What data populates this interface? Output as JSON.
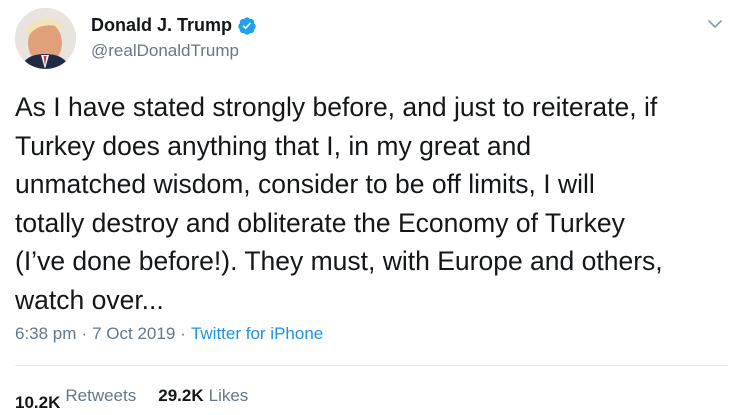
{
  "user": {
    "display_name": "Donald J. Trump",
    "handle": "@realDonaldTrump",
    "verified": true
  },
  "icons": {
    "verified": "verified-badge-icon",
    "menu": "chevron-down-icon"
  },
  "tweet": {
    "text": "As I have stated strongly before, and just to reiterate, if\nTurkey does anything that I, in my great and\nunmatched wisdom, consider to be off limits, I will\ntotally destroy and obliterate the Economy of Turkey\n(I’ve done before!). They must, with Europe and others,\nwatch over...",
    "time": "6:38 pm",
    "separator": "·",
    "date": "7 Oct 2019",
    "source": "Twitter for iPhone"
  },
  "stats": {
    "retweets_count": "10.2K",
    "retweets_label": "Retweets",
    "likes_count": "29.2K",
    "likes_label": "Likes"
  },
  "colors": {
    "accent": "#1da1f2",
    "link": "#1b95e0",
    "secondary_text": "#657786",
    "primary_text": "#14171a",
    "divider": "#e6ecf0"
  }
}
